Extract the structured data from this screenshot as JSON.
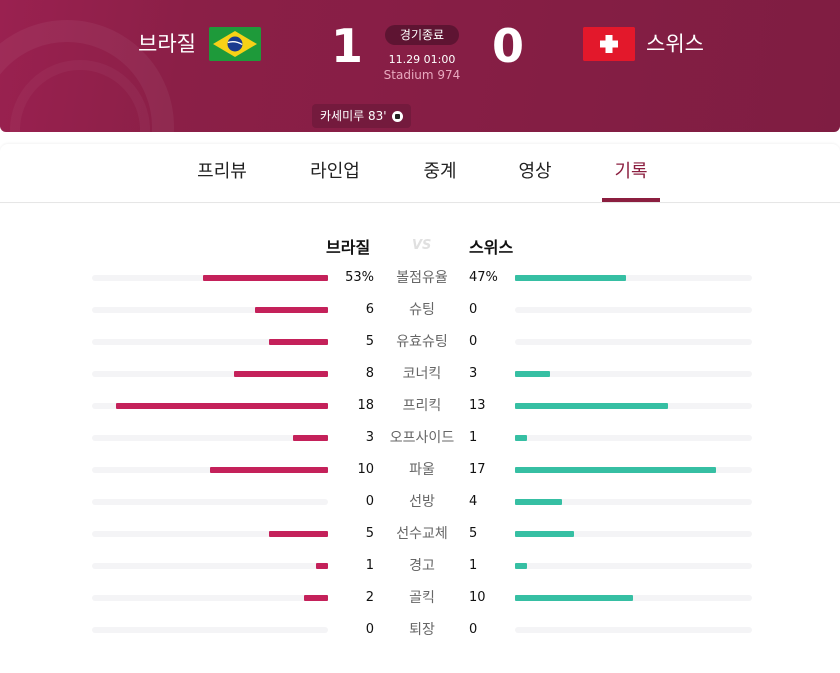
{
  "match": {
    "home_team": "브라질",
    "away_team": "스위스",
    "home_score": "1",
    "away_score": "0",
    "status": "경기종료",
    "datetime": "11.29 01:00",
    "venue": "Stadium 974",
    "goal_scorer": "카세미루 83'"
  },
  "tabs": [
    "프리뷰",
    "라인업",
    "중계",
    "영상",
    "기록"
  ],
  "active_tab": "기록",
  "stats": {
    "home_title": "브라질",
    "vs": "VS",
    "away_title": "스위스",
    "rows": [
      {
        "label": "볼점유율",
        "home": "53%",
        "away": "47%",
        "home_ratio": 0.53,
        "away_ratio": 0.47
      },
      {
        "label": "슈팅",
        "home": "6",
        "away": "0",
        "home_ratio": 0.31,
        "away_ratio": 0.0
      },
      {
        "label": "유효슈팅",
        "home": "5",
        "away": "0",
        "home_ratio": 0.25,
        "away_ratio": 0.0
      },
      {
        "label": "코너킥",
        "home": "8",
        "away": "3",
        "home_ratio": 0.4,
        "away_ratio": 0.15
      },
      {
        "label": "프리킥",
        "home": "18",
        "away": "13",
        "home_ratio": 0.9,
        "away_ratio": 0.65
      },
      {
        "label": "오프사이드",
        "home": "3",
        "away": "1",
        "home_ratio": 0.15,
        "away_ratio": 0.05
      },
      {
        "label": "파울",
        "home": "10",
        "away": "17",
        "home_ratio": 0.5,
        "away_ratio": 0.85
      },
      {
        "label": "선방",
        "home": "0",
        "away": "4",
        "home_ratio": 0.0,
        "away_ratio": 0.2
      },
      {
        "label": "선수교체",
        "home": "5",
        "away": "5",
        "home_ratio": 0.25,
        "away_ratio": 0.25
      },
      {
        "label": "경고",
        "home": "1",
        "away": "1",
        "home_ratio": 0.05,
        "away_ratio": 0.05
      },
      {
        "label": "골킥",
        "home": "2",
        "away": "10",
        "home_ratio": 0.1,
        "away_ratio": 0.5
      },
      {
        "label": "퇴장",
        "home": "0",
        "away": "0",
        "home_ratio": 0.0,
        "away_ratio": 0.0
      }
    ]
  },
  "colors": {
    "header_bg": "#8b1f47",
    "home_bar": "#c4215a",
    "away_bar": "#36bfa3",
    "active_tab": "#8b1e3f"
  },
  "icons": {
    "home_flag": "brazil-flag-icon",
    "away_flag": "switzerland-flag-icon",
    "goal": "soccer-ball-icon"
  }
}
